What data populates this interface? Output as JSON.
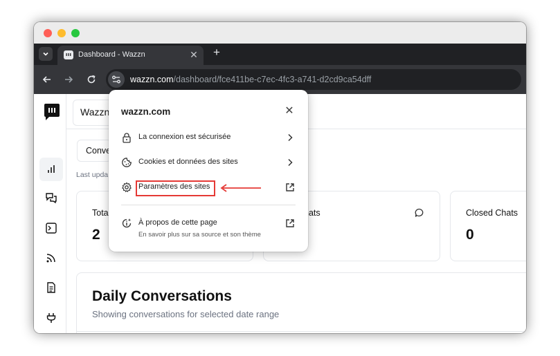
{
  "browser": {
    "tab_title": "Dashboard - Wazzn",
    "url_host": "wazzn.com",
    "url_path": "/dashboard/fce411be-c7ec-4fc3-a741-d2cd9ca54dff"
  },
  "window_colors": {
    "close": "#ff5f57",
    "minimize": "#febc2e",
    "maximize": "#28c840"
  },
  "app": {
    "workspace_label": "Wazzn",
    "conversations_tab": "Conve",
    "last_updated": "Last upda",
    "cards": [
      {
        "label": "Tota",
        "value": "2"
      },
      {
        "label": "hats",
        "value": ""
      },
      {
        "label": "Closed Chats",
        "value": "0"
      }
    ],
    "daily": {
      "title": "Daily Conversations",
      "subtitle": "Showing conversations for selected date range"
    },
    "sidebar_icons": [
      "chart-icon",
      "chat-bubbles-icon",
      "terminal-icon",
      "rss-icon",
      "document-icon",
      "plug-icon",
      "users-icon"
    ]
  },
  "popup": {
    "domain": "wazzn.com",
    "connection": "La connexion est sécurisée",
    "cookies": "Cookies et données des sites",
    "site_settings": "Paramètres des sites",
    "about": "À propos de cette page",
    "about_sub": "En savoir plus sur sa source et son thème"
  },
  "annotation": {
    "color": "#e53935"
  }
}
